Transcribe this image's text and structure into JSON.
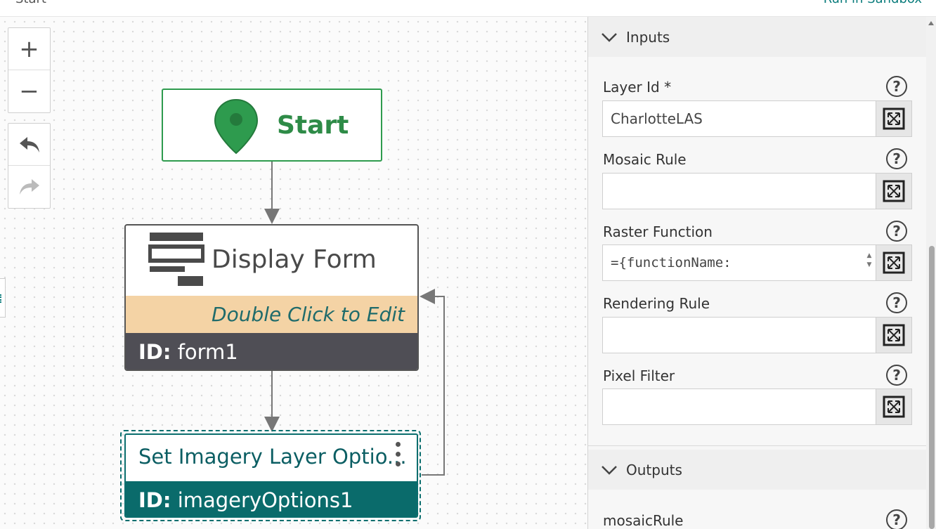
{
  "topbar": {
    "crumb": "Start",
    "sandbox_link": "Run in Sandbox"
  },
  "toolbar": {
    "zoom_in": "+",
    "zoom_out": "−",
    "undo": "undo",
    "redo": "redo"
  },
  "nodes": {
    "start": {
      "title": "Start",
      "icon": "map-pin-icon",
      "color": "#2e9b4e"
    },
    "form": {
      "title": "Display Form",
      "hint": "Double Click to Edit",
      "id_label": "ID:",
      "id_value": "form1",
      "hint_bg": "#f4d3a5"
    },
    "imagery": {
      "title": "Set Imagery Layer Optio...",
      "id_label": "ID:",
      "id_value": "imageryOptions1",
      "color": "#0a6b6b"
    }
  },
  "panel": {
    "inputs_header": "Inputs",
    "outputs_header": "Outputs",
    "fields": [
      {
        "label": "Layer Id",
        "required": "*",
        "value": "CharlotteLAS"
      },
      {
        "label": "Mosaic Rule",
        "value": ""
      },
      {
        "label": "Raster Function",
        "value": "={functionName:"
      },
      {
        "label": "Rendering Rule",
        "value": ""
      },
      {
        "label": "Pixel Filter",
        "value": ""
      }
    ],
    "outputs": [
      {
        "label": "mosaicRule"
      }
    ],
    "help_glyph": "?"
  }
}
